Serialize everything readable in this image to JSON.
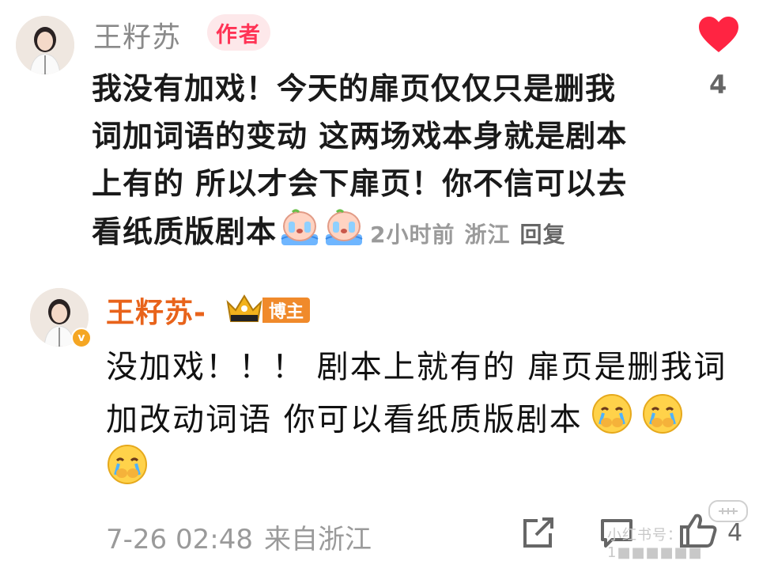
{
  "comment_author": {
    "name": "王籽苏",
    "badge": "作者",
    "like_count": "4",
    "body_lines": [
      "我没有加戏！今天的扉页仅仅只是删我",
      "词加词语的变动 这两场戏本身就是剧本",
      "上有的 所以才会下扉页！你不信可以去",
      "看纸质版剧本"
    ],
    "emoji_names": [
      "crying-emoji",
      "crying-emoji"
    ],
    "time": "2小时前",
    "location": "浙江",
    "reply_label": "回复",
    "accent": "#ff3355"
  },
  "comment_blogger": {
    "name": "王籽苏-",
    "badge": "博主",
    "body_lines": [
      "没加戏！！！ 剧本上就有的 扉页是删我词",
      "加改动词语 你可以看纸质版剧本"
    ],
    "emoji_names": [
      "tearful-face-emoji",
      "tearful-face-emoji",
      "tearful-face-emoji"
    ],
    "time": "7-26 02:48",
    "source": "来自浙江",
    "like_count": "4",
    "accent": "#e8631b"
  },
  "watermark": {
    "text": "小红书号：1■■■■■■"
  }
}
